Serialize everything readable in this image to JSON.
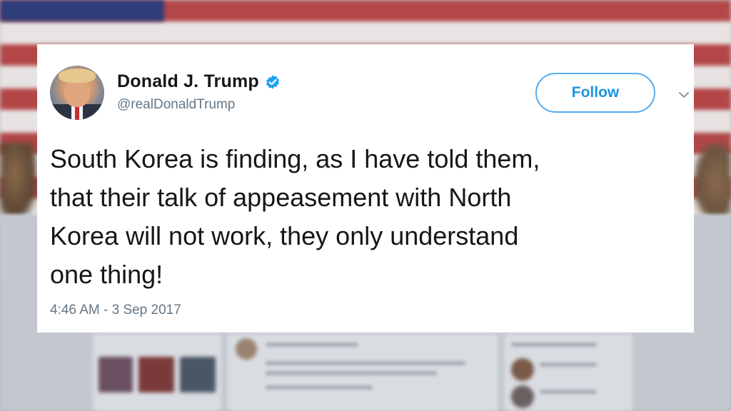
{
  "tweet": {
    "author_name": "Donald J. Trump",
    "handle": "@realDonaldTrump",
    "follow_label": "Follow",
    "text": "South Korea is finding, as I have told them,\nthat their talk of appeasement with North\nKorea will not work, they only understand\none thing!",
    "timestamp": "4:46 AM - 3 Sep 2017",
    "verified": true
  },
  "icons": {
    "verified": "verified-badge-icon",
    "menu": "chevron-down-icon",
    "avatar": "profile-avatar"
  },
  "colors": {
    "accent": "#1da1f2",
    "follow_border": "#55acee",
    "text_primary": "#14171a",
    "text_secondary": "#657786"
  }
}
